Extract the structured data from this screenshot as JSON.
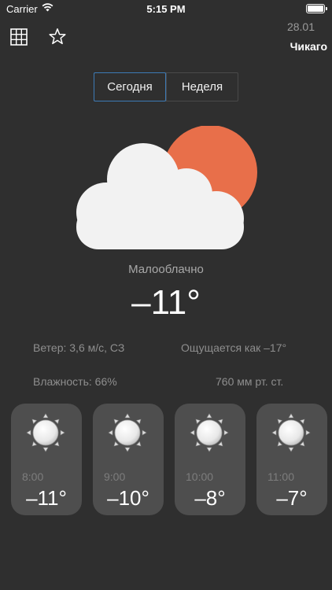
{
  "status_bar": {
    "carrier": "Carrier",
    "time": "5:15 PM"
  },
  "header": {
    "date": "28.01",
    "city": "Чикаго",
    "left_icons": [
      "grid-icon",
      "star-icon"
    ]
  },
  "tabs": [
    {
      "label": "Сегодня",
      "selected": true
    },
    {
      "label": "Неделя",
      "selected": false
    }
  ],
  "current": {
    "condition": "Малооблачно",
    "temperature": "–11°",
    "wind": "Ветер: 3,6 м/с, СЗ",
    "feels_like": "Ощущается как –17°",
    "humidity": "Влажность: 66%",
    "pressure": "760 мм рт. ст."
  },
  "hourly": [
    {
      "time": "8:00",
      "temp": "–11°",
      "icon": "sun-icon"
    },
    {
      "time": "9:00",
      "temp": "–10°",
      "icon": "sun-icon"
    },
    {
      "time": "10:00",
      "temp": "–8°",
      "icon": "sun-icon"
    },
    {
      "time": "11:00",
      "temp": "–7°",
      "icon": "sun-icon"
    }
  ],
  "colors": {
    "background": "#2f2f2f",
    "card": "#4e4e4e",
    "sun": "#e86f4a",
    "cloud": "#f2f2f2",
    "accent_border": "#3d7ab5"
  }
}
